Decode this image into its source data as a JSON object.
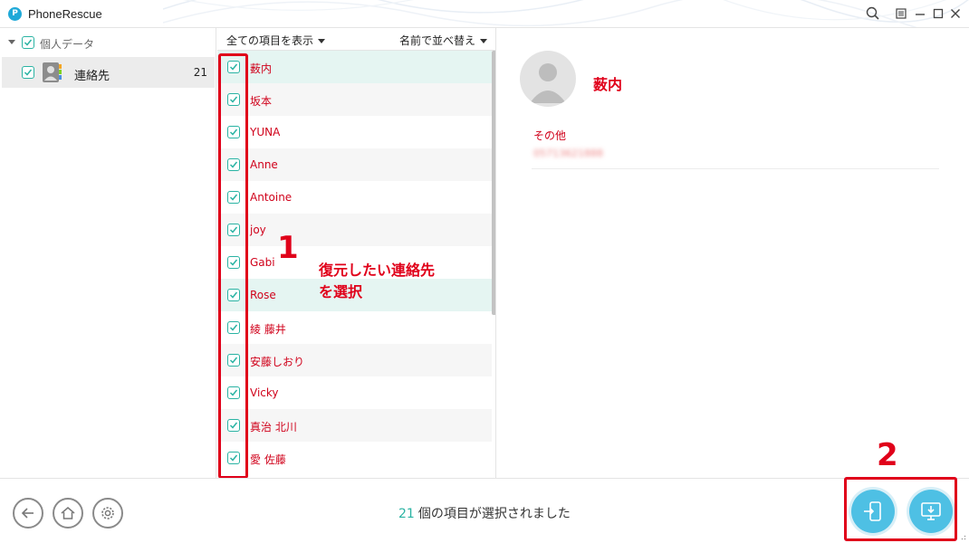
{
  "window": {
    "title": "PhoneRescue",
    "logo_letter": "P"
  },
  "sidebar": {
    "group_label": "個人データ",
    "category": {
      "label": "連絡先",
      "count": "21"
    }
  },
  "list": {
    "show_all_label": "全ての項目を表示",
    "sort_label": "名前で並べ替え",
    "contacts": [
      {
        "name": "薮内"
      },
      {
        "name": "坂本"
      },
      {
        "name": "YUNA"
      },
      {
        "name": "Anne"
      },
      {
        "name": "Antoine"
      },
      {
        "name": "joy"
      },
      {
        "name": "Gabi"
      },
      {
        "name": "Rose"
      },
      {
        "name": "綾 藤井"
      },
      {
        "name": "安藤しおり"
      },
      {
        "name": "Vicky"
      },
      {
        "name": "真治 北川"
      },
      {
        "name": "愛 佐藤"
      }
    ]
  },
  "detail": {
    "name": "薮内",
    "field_label": "その他",
    "field_value": "05713621888"
  },
  "annotations": {
    "step1_number": "1",
    "step1_text_line1": "復元したい連絡先",
    "step1_text_line2": "を選択",
    "step2_number": "2"
  },
  "bottom": {
    "selected_count": "21",
    "status_text": "個の項目が選択されました"
  },
  "colors": {
    "accent": "#2ab3a3",
    "action_blue": "#4ec0e4",
    "annotation_red": "#e0001a"
  }
}
